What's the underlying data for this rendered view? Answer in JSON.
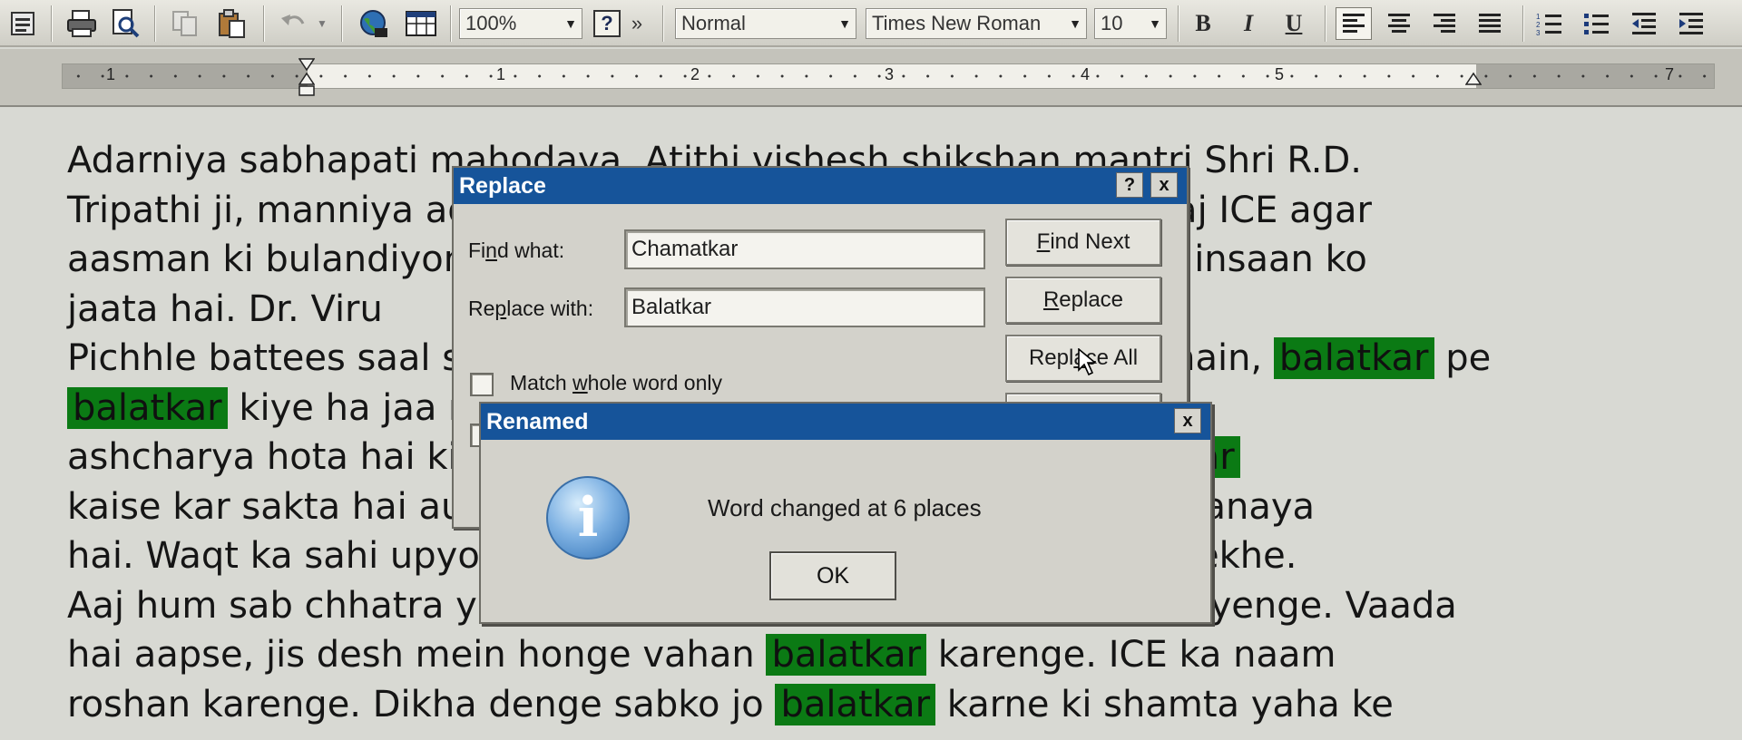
{
  "toolbar": {
    "zoom": "100%",
    "help": "?",
    "overflow": "»",
    "style": "Normal",
    "font": "Times New Roman",
    "size": "10",
    "bold": "B",
    "italic": "I",
    "underline": "U",
    "icons": [
      "file-icon",
      "print-icon",
      "print-preview-icon",
      "copy-icon",
      "paste-icon",
      "undo-icon",
      "web-globe-icon",
      "table-icon",
      "align-left-icon",
      "align-center-icon",
      "align-right-icon",
      "justify-icon",
      "numbered-list-icon",
      "bullet-list-icon",
      "decrease-indent-icon",
      "increase-indent-icon"
    ]
  },
  "ruler": {
    "numbers": [
      "1",
      "1",
      "2",
      "3",
      "4",
      "5",
      "7"
    ]
  },
  "document": {
    "highlight_color": "#0b7a14",
    "lines": [
      {
        "segments": [
          {
            "t": "Adarniya sabhapati mahodaya, Atithi vishesh shikshan mantri Shri R.D."
          }
        ]
      },
      {
        "segments": [
          {
            "t": "Tripathi ji, manniya adhyapakon aur mere pyaare saathiyo. Aaj ICE agar"
          }
        ]
      },
      {
        "segments": [
          {
            "t": "aasman ki bulandiyon tak pahucha hai, to uska shreya sirf ek insaan ko"
          }
        ]
      },
      {
        "segments": [
          {
            "t": "jaata hai. Dr. Viru"
          }
        ]
      },
      {
        "segments": [
          {
            "t": "Pichhle battees saal se ye ICE ke har vidyarthi ko sikha rahe hain, "
          },
          {
            "t": "balatkar",
            "hl": true
          },
          {
            "t": " pe"
          }
        ]
      },
      {
        "segments": [
          {
            "t": " "
          },
          {
            "t": "balatkar",
            "hl": true
          },
          {
            "t": " kiye ha jaa rahe hain aur karte rahenge. Hame to"
          }
        ]
      },
      {
        "segments": [
          {
            "t": "ashcharya hota hai ki ek insaan akela itne saal tak itne "
          },
          {
            "t": "balatkar",
            "hl": true
          }
        ]
      },
      {
        "segments": [
          {
            "t": "kaise kar sakta hai aur humein bhi isne hi is kaam ko is kabil banaya"
          }
        ]
      },
      {
        "segments": [
          {
            "t": "hai. Waqt ka sahi upyog kaise karna hai ye sab humne inse seekhe."
          }
        ]
      },
      {
        "segments": [
          {
            "t": "Aaj hum sab chhatra yahan nahin kal desh videsh mein phel jayenge. Vaada"
          }
        ]
      },
      {
        "segments": [
          {
            "t": "hai aapse, jis desh mein honge vahan "
          },
          {
            "t": "balatkar",
            "hl": true
          },
          {
            "t": " karenge. ICE ka naam"
          }
        ]
      },
      {
        "segments": [
          {
            "t": "roshan karenge. Dikha denge sabko jo "
          },
          {
            "t": "balatkar",
            "hl": true
          },
          {
            "t": " karne ki shamta yaha ke"
          }
        ]
      }
    ]
  },
  "replace_dialog": {
    "title": "Replace",
    "help_button": "?",
    "close_button": "x",
    "find_label_pre": "Fi",
    "find_label_u": "n",
    "find_label_post": "d what:",
    "find_value": "Chamatkar",
    "replace_label_pre": "Re",
    "replace_label_u": "p",
    "replace_label_post": "lace with:",
    "replace_value": "Balatkar",
    "find_next_u": "F",
    "find_next_rest": "ind Next",
    "replace_btn_u": "R",
    "replace_btn_rest": "eplace",
    "replace_all_pre": "Repl",
    "replace_all_u": "a",
    "replace_all_post": "ce All",
    "match_pre": "Match ",
    "match_u": "w",
    "match_post": "hole word only"
  },
  "renamed_dialog": {
    "title": "Renamed",
    "close_button": "x",
    "message": "Word changed at 6 places",
    "ok": "OK",
    "icon": "info-icon"
  }
}
